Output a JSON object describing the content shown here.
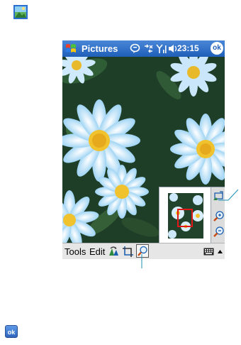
{
  "title_bar": {
    "app_title": "Pictures",
    "time": "23:15",
    "ok_label": "ok"
  },
  "menu_bar": {
    "tools_label": "Tools",
    "edit_label": "Edit"
  },
  "bottom": {
    "ok_label": "ok"
  },
  "icons": {
    "top": "picture-icon",
    "start": "windows-flag-icon",
    "status": [
      "messaging-icon",
      "connectivity-icon",
      "signal-icon",
      "volume-icon"
    ],
    "toolbar": [
      "rotate-icon",
      "crop-icon",
      "zoom-icon",
      "keyboard-icon",
      "up-arrow-icon"
    ],
    "zoom_panel": [
      "zoom-to-fit-icon",
      "zoom-in-icon",
      "zoom-out-icon"
    ]
  },
  "colors": {
    "title_bar": "#1f5fb9",
    "menu_bar": "#e6e6e6",
    "zoom_rect": "#e01818",
    "callout": "#1a8fb6"
  }
}
